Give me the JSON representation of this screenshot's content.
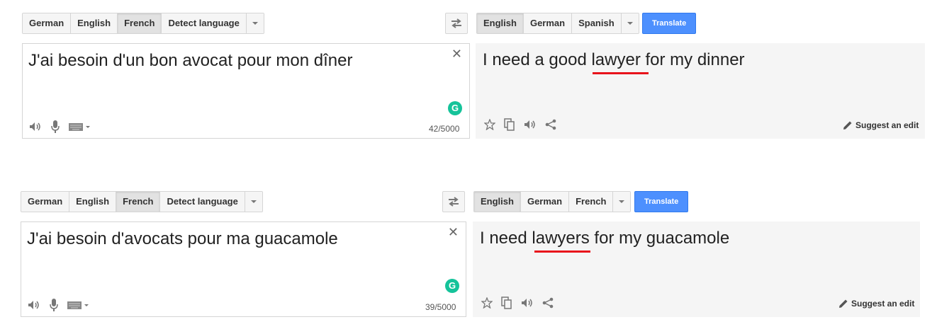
{
  "panels": [
    {
      "source_langs": [
        "German",
        "English",
        "French",
        "Detect language"
      ],
      "source_selected": "French",
      "target_langs": [
        "English",
        "German",
        "Spanish"
      ],
      "target_selected": "English",
      "translate_label": "Translate",
      "source_text": "J'ai besoin d'un bon avocat pour mon dîner",
      "char_count": "42/5000",
      "target_before": "I need a good ",
      "target_highlight": "lawyer",
      "target_after": " for my dinner",
      "suggest_label": "Suggest an edit"
    },
    {
      "source_langs": [
        "German",
        "English",
        "French",
        "Detect language"
      ],
      "source_selected": "French",
      "target_langs": [
        "English",
        "German",
        "French"
      ],
      "target_selected": "English",
      "translate_label": "Translate",
      "source_text": "J'ai besoin d'avocats pour ma guacamole",
      "char_count": "39/5000",
      "target_before": "I need ",
      "target_highlight": "lawyers",
      "target_after": " for my guacamole",
      "suggest_label": "Suggest an edit"
    }
  ],
  "colors": {
    "accent": "#4d90fe",
    "highlight": "#e8131b",
    "grammarly": "#15c39a"
  },
  "icons": {
    "speaker": "speaker-icon",
    "mic": "microphone-icon",
    "keyboard": "keyboard-icon",
    "star": "star-icon",
    "copy": "copy-icon",
    "share": "share-icon",
    "pencil": "pencil-icon",
    "swap": "swap-languages-icon",
    "clear": "close-icon",
    "grammarly": "grammarly-icon"
  }
}
